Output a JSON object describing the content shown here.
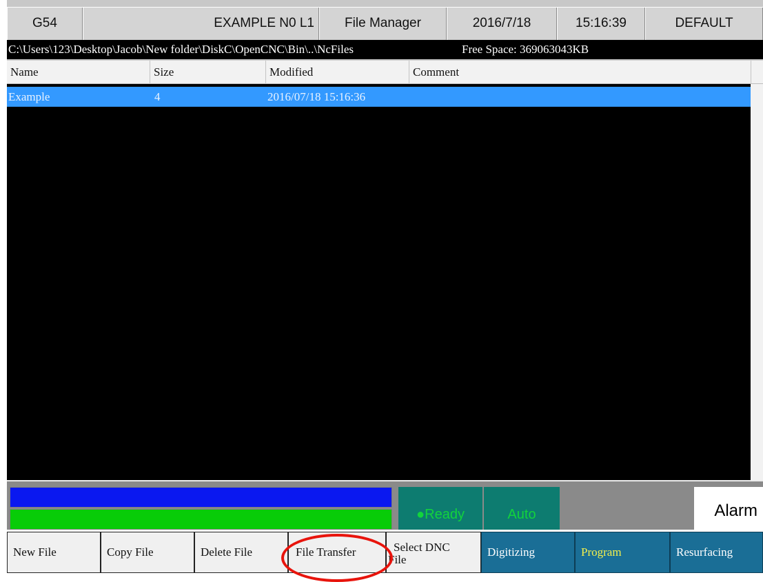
{
  "header": {
    "coordinate_system": "G54",
    "program_name": "EXAMPLE N0 L1",
    "screen_title": "File Manager",
    "date": "2016/7/18",
    "time": "15:16:39",
    "profile": "DEFAULT"
  },
  "pathbar": {
    "path": "C:\\Users\\123\\Desktop\\Jacob\\New folder\\DiskC\\OpenCNC\\Bin\\..\\NcFiles",
    "free_space": "Free Space: 369063043KB"
  },
  "file_list": {
    "columns": [
      "Name",
      "Size",
      "Modified",
      "Comment"
    ],
    "rows": [
      {
        "name": "Example",
        "size": "4",
        "modified": "2016/07/18 15:16:36",
        "comment": "",
        "selected": true
      }
    ]
  },
  "status": {
    "ready_label": "Ready",
    "mode_label": "Auto",
    "alarm_label": "Alarm",
    "colors": {
      "ready_bg": "#0d7c70",
      "indicator_text": "#12d43c",
      "blue_bar": "#0a18f0",
      "green_bar": "#08cc08"
    }
  },
  "buttons": {
    "new_file": "New File",
    "copy_file": "Copy File",
    "delete_file": "Delete File",
    "file_transfer": "File Transfer",
    "select_dnc_line1": "Select DNC",
    "select_dnc_line2": "File",
    "digitizing": "Digitizing",
    "program": "Program",
    "resurfacing": "Resurfacing"
  },
  "annotation": {
    "highlight_color": "#e8140c",
    "highlighted_button": "File Transfer"
  }
}
